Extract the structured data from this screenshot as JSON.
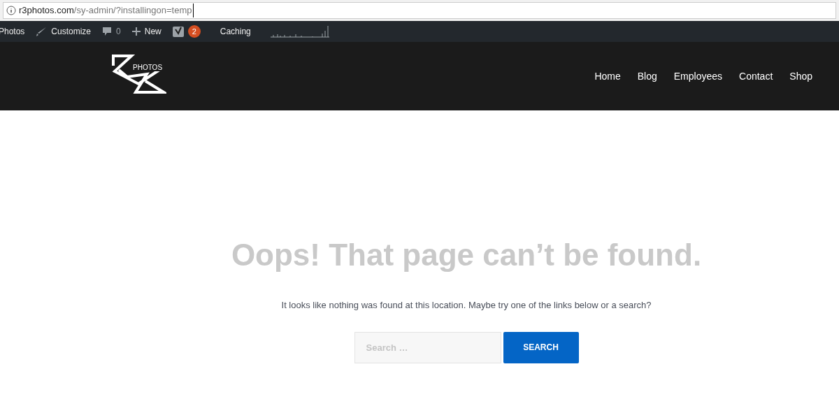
{
  "address_bar": {
    "host": "r3photos.com",
    "path": "/sy-admin/?installingon=temp"
  },
  "admin_bar": {
    "items": [
      {
        "kind": "site",
        "label": "Photos"
      },
      {
        "kind": "customize",
        "label": "Customize"
      },
      {
        "kind": "comments",
        "label": "0"
      },
      {
        "kind": "new",
        "label": "New"
      },
      {
        "kind": "seo",
        "label": "2"
      },
      {
        "kind": "text",
        "label": "Caching"
      },
      {
        "kind": "graph"
      }
    ]
  },
  "header": {
    "logo_text": "PHOTOS",
    "nav": [
      {
        "label": "Home"
      },
      {
        "label": "Blog"
      },
      {
        "label": "Employees"
      },
      {
        "label": "Contact"
      },
      {
        "label": "Shop"
      }
    ]
  },
  "content": {
    "title": "Oops! That page can’t be found.",
    "message": "It looks like nothing was found at this location. Maybe try one of the links below or a search?",
    "search": {
      "placeholder": "Search …",
      "button": "SEARCH"
    }
  }
}
